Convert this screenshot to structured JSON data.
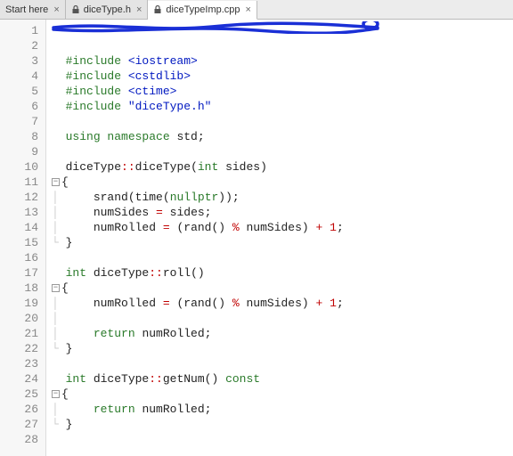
{
  "tabs": [
    {
      "label": "Start here",
      "locked": false,
      "active": false
    },
    {
      "label": "diceType.h",
      "locked": true,
      "active": false
    },
    {
      "label": "diceTypeImp.cpp",
      "locked": true,
      "active": true
    }
  ],
  "close_glyph": "×",
  "fold_glyph": "−",
  "line_count": 28,
  "code_lines": [
    {
      "n": 1,
      "redacted": true,
      "tokens": []
    },
    {
      "n": 2,
      "tokens": []
    },
    {
      "n": 3,
      "tokens": [
        [
          "pp",
          "#include "
        ],
        [
          "str",
          "<iostream>"
        ]
      ]
    },
    {
      "n": 4,
      "tokens": [
        [
          "pp",
          "#include "
        ],
        [
          "str",
          "<cstdlib>"
        ]
      ]
    },
    {
      "n": 5,
      "tokens": [
        [
          "pp",
          "#include "
        ],
        [
          "str",
          "<ctime>"
        ]
      ]
    },
    {
      "n": 6,
      "tokens": [
        [
          "pp",
          "#include "
        ],
        [
          "str",
          "\"diceType.h\""
        ]
      ]
    },
    {
      "n": 7,
      "tokens": []
    },
    {
      "n": 8,
      "tokens": [
        [
          "kw",
          "using "
        ],
        [
          "kw",
          "namespace "
        ],
        [
          "id",
          "std"
        ],
        [
          "id",
          ";"
        ]
      ]
    },
    {
      "n": 9,
      "tokens": []
    },
    {
      "n": 10,
      "tokens": [
        [
          "id",
          "diceType"
        ],
        [
          "op",
          "::"
        ],
        [
          "fn",
          "diceType"
        ],
        [
          "id",
          "("
        ],
        [
          "kw",
          "int"
        ],
        [
          "id",
          " sides)"
        ]
      ]
    },
    {
      "n": 11,
      "fold": true,
      "tokens": [
        [
          "id",
          "{"
        ]
      ]
    },
    {
      "n": 12,
      "guide": true,
      "indent": 1,
      "tokens": [
        [
          "fn",
          "srand"
        ],
        [
          "id",
          "("
        ],
        [
          "fn",
          "time"
        ],
        [
          "id",
          "("
        ],
        [
          "kw",
          "nullptr"
        ],
        [
          "id",
          "));"
        ]
      ]
    },
    {
      "n": 13,
      "guide": true,
      "indent": 1,
      "tokens": [
        [
          "id",
          "numSides "
        ],
        [
          "op",
          "="
        ],
        [
          "id",
          " sides;"
        ]
      ]
    },
    {
      "n": 14,
      "guide": true,
      "indent": 1,
      "tokens": [
        [
          "id",
          "numRolled "
        ],
        [
          "op",
          "="
        ],
        [
          "id",
          " ("
        ],
        [
          "fn",
          "rand"
        ],
        [
          "id",
          "() "
        ],
        [
          "op",
          "%"
        ],
        [
          "id",
          " numSides) "
        ],
        [
          "op",
          "+"
        ],
        [
          "id",
          " "
        ],
        [
          "num",
          "1"
        ],
        [
          "id",
          ";"
        ]
      ]
    },
    {
      "n": 15,
      "guide_end": true,
      "tokens": [
        [
          "id",
          "}"
        ]
      ]
    },
    {
      "n": 16,
      "tokens": []
    },
    {
      "n": 17,
      "tokens": [
        [
          "kw",
          "int"
        ],
        [
          "id",
          " diceType"
        ],
        [
          "op",
          "::"
        ],
        [
          "fn",
          "roll"
        ],
        [
          "id",
          "()"
        ]
      ]
    },
    {
      "n": 18,
      "fold": true,
      "tokens": [
        [
          "id",
          "{"
        ]
      ]
    },
    {
      "n": 19,
      "guide": true,
      "indent": 1,
      "tokens": [
        [
          "id",
          "numRolled "
        ],
        [
          "op",
          "="
        ],
        [
          "id",
          " ("
        ],
        [
          "fn",
          "rand"
        ],
        [
          "id",
          "() "
        ],
        [
          "op",
          "%"
        ],
        [
          "id",
          " numSides) "
        ],
        [
          "op",
          "+"
        ],
        [
          "id",
          " "
        ],
        [
          "num",
          "1"
        ],
        [
          "id",
          ";"
        ]
      ]
    },
    {
      "n": 20,
      "guide": true,
      "indent": 0,
      "tokens": []
    },
    {
      "n": 21,
      "guide": true,
      "indent": 1,
      "tokens": [
        [
          "kw",
          "return"
        ],
        [
          "id",
          " numRolled;"
        ]
      ]
    },
    {
      "n": 22,
      "guide_end": true,
      "tokens": [
        [
          "id",
          "}"
        ]
      ]
    },
    {
      "n": 23,
      "tokens": []
    },
    {
      "n": 24,
      "tokens": [
        [
          "kw",
          "int"
        ],
        [
          "id",
          " diceType"
        ],
        [
          "op",
          "::"
        ],
        [
          "fn",
          "getNum"
        ],
        [
          "id",
          "() "
        ],
        [
          "kw",
          "const"
        ]
      ]
    },
    {
      "n": 25,
      "fold": true,
      "tokens": [
        [
          "id",
          "{"
        ]
      ]
    },
    {
      "n": 26,
      "guide": true,
      "indent": 1,
      "tokens": [
        [
          "kw",
          "return"
        ],
        [
          "id",
          " numRolled;"
        ]
      ]
    },
    {
      "n": 27,
      "guide_end": true,
      "indent": 0,
      "tokens": [
        [
          "id",
          "}"
        ]
      ]
    },
    {
      "n": 28,
      "tokens": []
    }
  ]
}
